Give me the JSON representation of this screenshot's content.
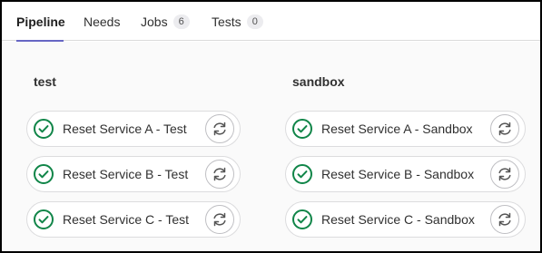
{
  "tabs": {
    "pipeline": {
      "label": "Pipeline"
    },
    "needs": {
      "label": "Needs"
    },
    "jobs": {
      "label": "Jobs",
      "count": "6"
    },
    "tests": {
      "label": "Tests",
      "count": "0"
    }
  },
  "stages": [
    {
      "title": "test",
      "jobs": [
        {
          "name": "Reset Service A - Test"
        },
        {
          "name": "Reset Service B - Test"
        },
        {
          "name": "Reset Service C - Test"
        }
      ]
    },
    {
      "title": "sandbox",
      "jobs": [
        {
          "name": "Reset Service A - Sandbox"
        },
        {
          "name": "Reset Service B - Sandbox"
        },
        {
          "name": "Reset Service C - Sandbox"
        }
      ]
    }
  ],
  "icons": {
    "status": "success-check-icon",
    "retry": "retry-icon"
  },
  "colors": {
    "accent": "#6666c4",
    "success": "#108548"
  }
}
